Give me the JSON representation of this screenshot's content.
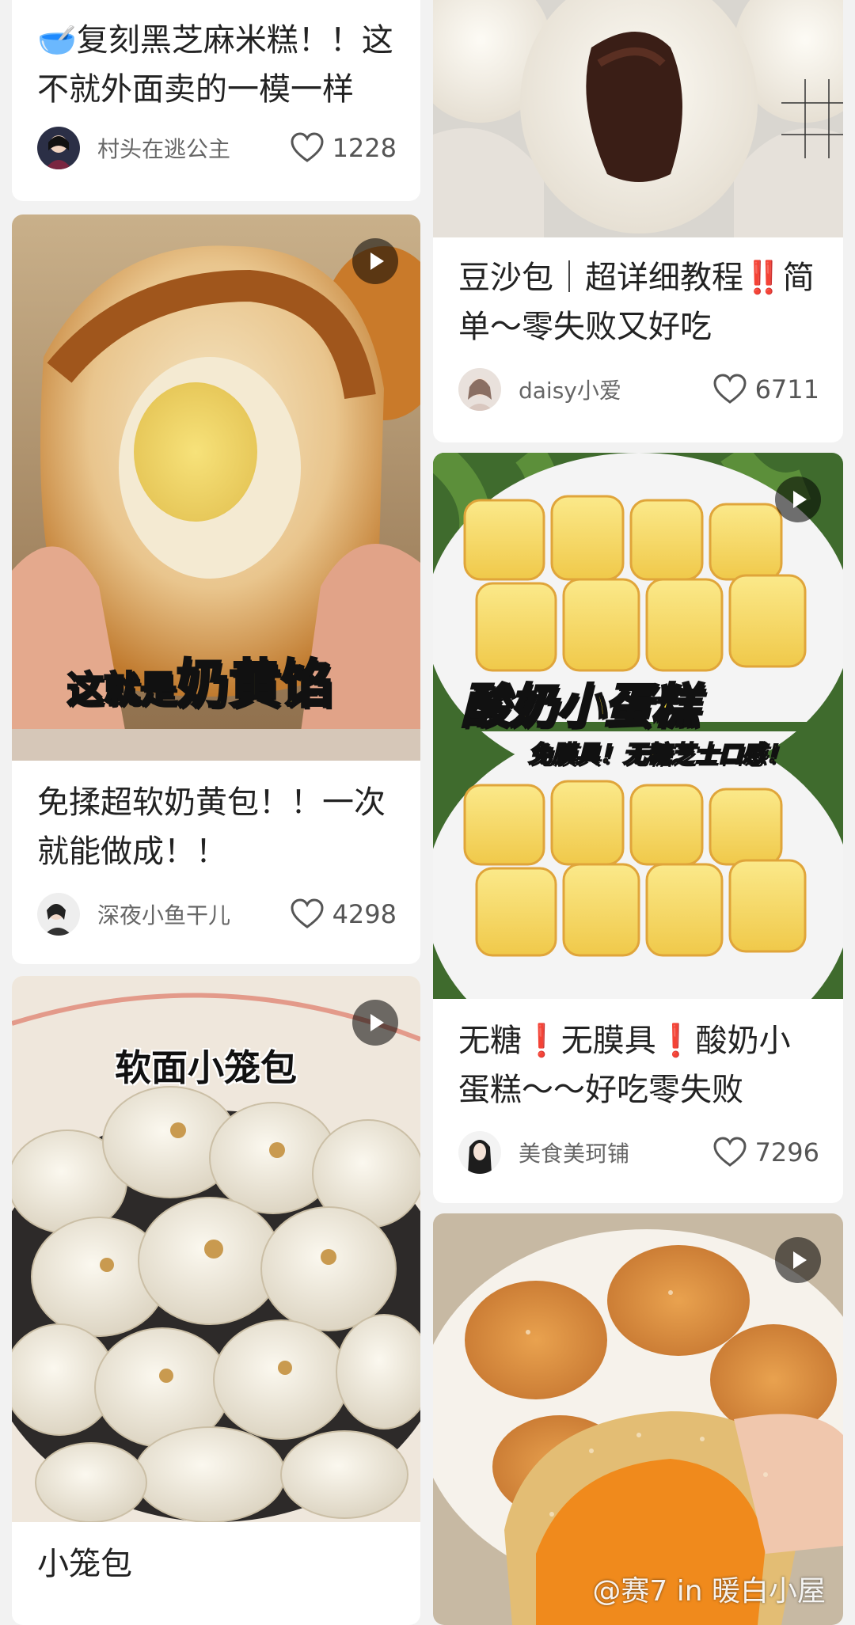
{
  "feed": {
    "left": [
      {
        "title": "🥣复刻黑芝麻米糕！！这不就外面卖的一模一样",
        "author": "村头在逃公主",
        "likes": "1228",
        "has_video": false
      },
      {
        "title": "免揉超软奶黄包！！一次就能做成！！",
        "author": "深夜小鱼干儿",
        "likes": "4298",
        "has_video": true,
        "overlay": {
          "prefix": "这就是",
          "highlight": "奶黄馅"
        }
      },
      {
        "title": "小笼包",
        "has_video": true,
        "overlay": {
          "caption": "软面小笼包"
        }
      }
    ],
    "right": [
      {
        "title": "豆沙包｜超详细教程‼️简单～零失败又好吃",
        "author": "daisy小爱",
        "likes": "6711",
        "has_video": false
      },
      {
        "title": "无糖❗无膜具❗酸奶小蛋糕～～好吃零失败",
        "author": "美食美珂铺",
        "likes": "7296",
        "has_video": true,
        "overlay": {
          "caption_top": "酸奶小蛋糕",
          "caption_sub": "免膜具！无糖芝士口感！"
        }
      },
      {
        "has_video": true,
        "watermark": "@赛7 in 暖白小屋"
      }
    ]
  },
  "icons": {
    "like": "heart-outline-icon",
    "video": "play-icon"
  },
  "colors": {
    "background": "#f2f2f2",
    "card": "#ffffff",
    "text": "#222222",
    "meta": "#666666",
    "overlay_yellow": "#ffe43a"
  }
}
